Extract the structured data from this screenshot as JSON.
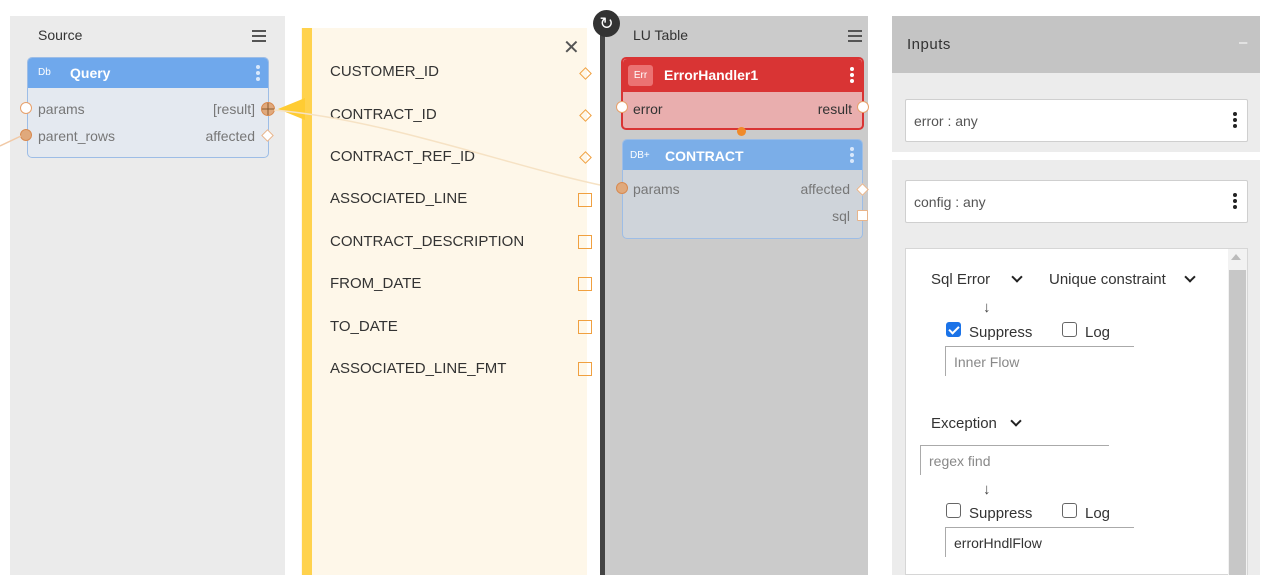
{
  "source": {
    "title": "Source",
    "node": {
      "badge": "Db",
      "title": "Query",
      "left_ports": [
        "params",
        "parent_rows"
      ],
      "right_ports": [
        "[result]",
        "affected"
      ]
    }
  },
  "mapping": {
    "fields": [
      {
        "name": "CUSTOMER_ID",
        "marker": "diamond"
      },
      {
        "name": "CONTRACT_ID",
        "marker": "diamond"
      },
      {
        "name": "CONTRACT_REF_ID",
        "marker": "diamond"
      },
      {
        "name": "ASSOCIATED_LINE",
        "marker": "square"
      },
      {
        "name": "CONTRACT_DESCRIPTION",
        "marker": "square"
      },
      {
        "name": "FROM_DATE",
        "marker": "square"
      },
      {
        "name": "TO_DATE",
        "marker": "square"
      },
      {
        "name": "ASSOCIATED_LINE_FMT",
        "marker": "square"
      }
    ]
  },
  "lu_table": {
    "title": "LU Table",
    "error_node": {
      "badge": "Err",
      "title": "ErrorHandler1",
      "left_port": "error",
      "right_port": "result"
    },
    "contract_node": {
      "badge": "DB+",
      "title": "CONTRACT",
      "left_port": "params",
      "right_ports": [
        "affected",
        "sql"
      ]
    }
  },
  "inputs": {
    "title": "Inputs",
    "collapse_symbol": "–",
    "error_field": "error : any",
    "config_field": "config : any",
    "sql_error": {
      "type": "Sql Error",
      "subtype": "Unique constraint",
      "arrow": "↓",
      "suppress_label": "Suppress",
      "suppress_checked": true,
      "log_label": "Log",
      "log_checked": false,
      "flow_placeholder": "Inner Flow"
    },
    "exception": {
      "type": "Exception",
      "regex_placeholder": "regex find",
      "arrow": "↓",
      "suppress_label": "Suppress",
      "suppress_checked": false,
      "log_label": "Log",
      "log_checked": false,
      "flow_value": "errorHndlFlow"
    }
  },
  "colors": {
    "query_head": "#6fa8ec",
    "error_head": "#d93434",
    "contract_head": "#7baee8",
    "accent_orange": "#f0a040"
  }
}
